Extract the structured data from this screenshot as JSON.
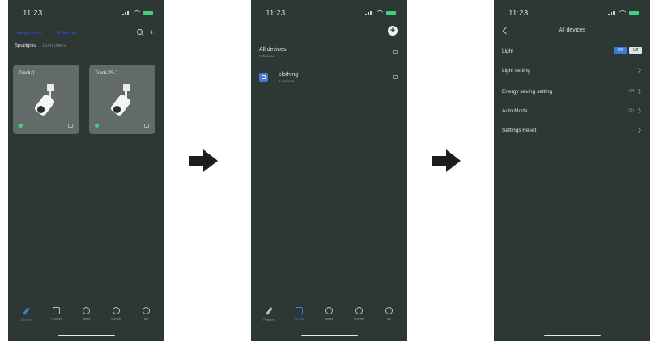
{
  "status_time": "11:23",
  "screen1": {
    "nav_left": "example store",
    "nav_right": "All devices",
    "tabs": [
      "Spotlights",
      "Controllers"
    ],
    "cards": [
      {
        "name": "Track-1"
      },
      {
        "name": "Track-25-1"
      }
    ],
    "bottom_nav": [
      "Devices",
      "Fixtures",
      "Ideas",
      "Scenes",
      "Me"
    ]
  },
  "screen2": {
    "groups": [
      {
        "title": "All devices",
        "subtitle": "2 devices"
      },
      {
        "title": "clothing",
        "subtitle": "2 devices"
      }
    ],
    "bottom_nav": [
      "Fixtures",
      "Group",
      "Ideas",
      "Scenes",
      "Me"
    ]
  },
  "screen3": {
    "title": "All devices",
    "settings": {
      "light_label": "Light",
      "light_on": "On",
      "light_off": "Off",
      "light_setting": "Light setting",
      "energy_label": "Energy saving setting",
      "energy_value": "Off",
      "auto_label": "Auto Mode",
      "auto_value": "On",
      "reset_label": "Settings Reset"
    }
  },
  "colors": {
    "background": "#2d3734",
    "accent": "#3a7bd9",
    "online": "#3ed37a"
  }
}
